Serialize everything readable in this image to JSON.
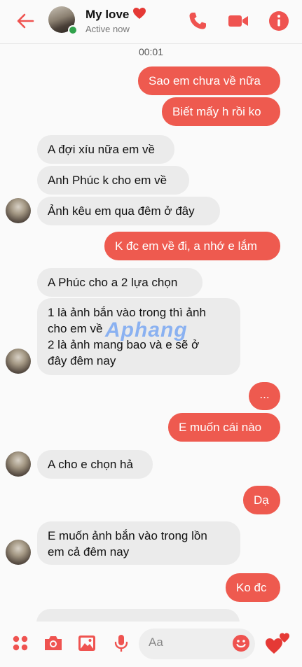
{
  "header": {
    "contact_name": "My love",
    "status": "Active now",
    "icons": [
      "back-arrow-icon",
      "phone-icon",
      "video-camera-icon",
      "info-icon"
    ]
  },
  "timestamp": "00:01",
  "messages": [
    "Sao em chưa về nữa",
    "Biết mấy h rồi ko",
    "A đợi xíu nữa em về",
    "Anh Phúc k cho em về",
    "Ảnh kêu em qua đêm ở đây",
    "K đc em về đi, a nhớ e lắm",
    "A Phúc cho a 2 lựa chọn",
    "1 là ảnh bắn vào trong thì ảnh",
    "cho em về",
    "2 là ảnh mang bao và e sẽ ở",
    "đây đêm nay",
    "...",
    "E muốn cái nào",
    "A cho e chọn hả",
    "Dạ",
    "E muốn ảnh bắn vào trong lồn",
    "em cả đêm nay",
    "Ko đc"
  ],
  "watermark": "Aphang",
  "composer": {
    "placeholder": "Aa",
    "icons": [
      "menu-dots-icon",
      "camera-icon",
      "gallery-icon",
      "microphone-icon",
      "emoji-icon",
      "hearts-icon"
    ]
  },
  "colors": {
    "accent": "#ee5a4f",
    "incoming_bubble": "#ebebeb"
  }
}
